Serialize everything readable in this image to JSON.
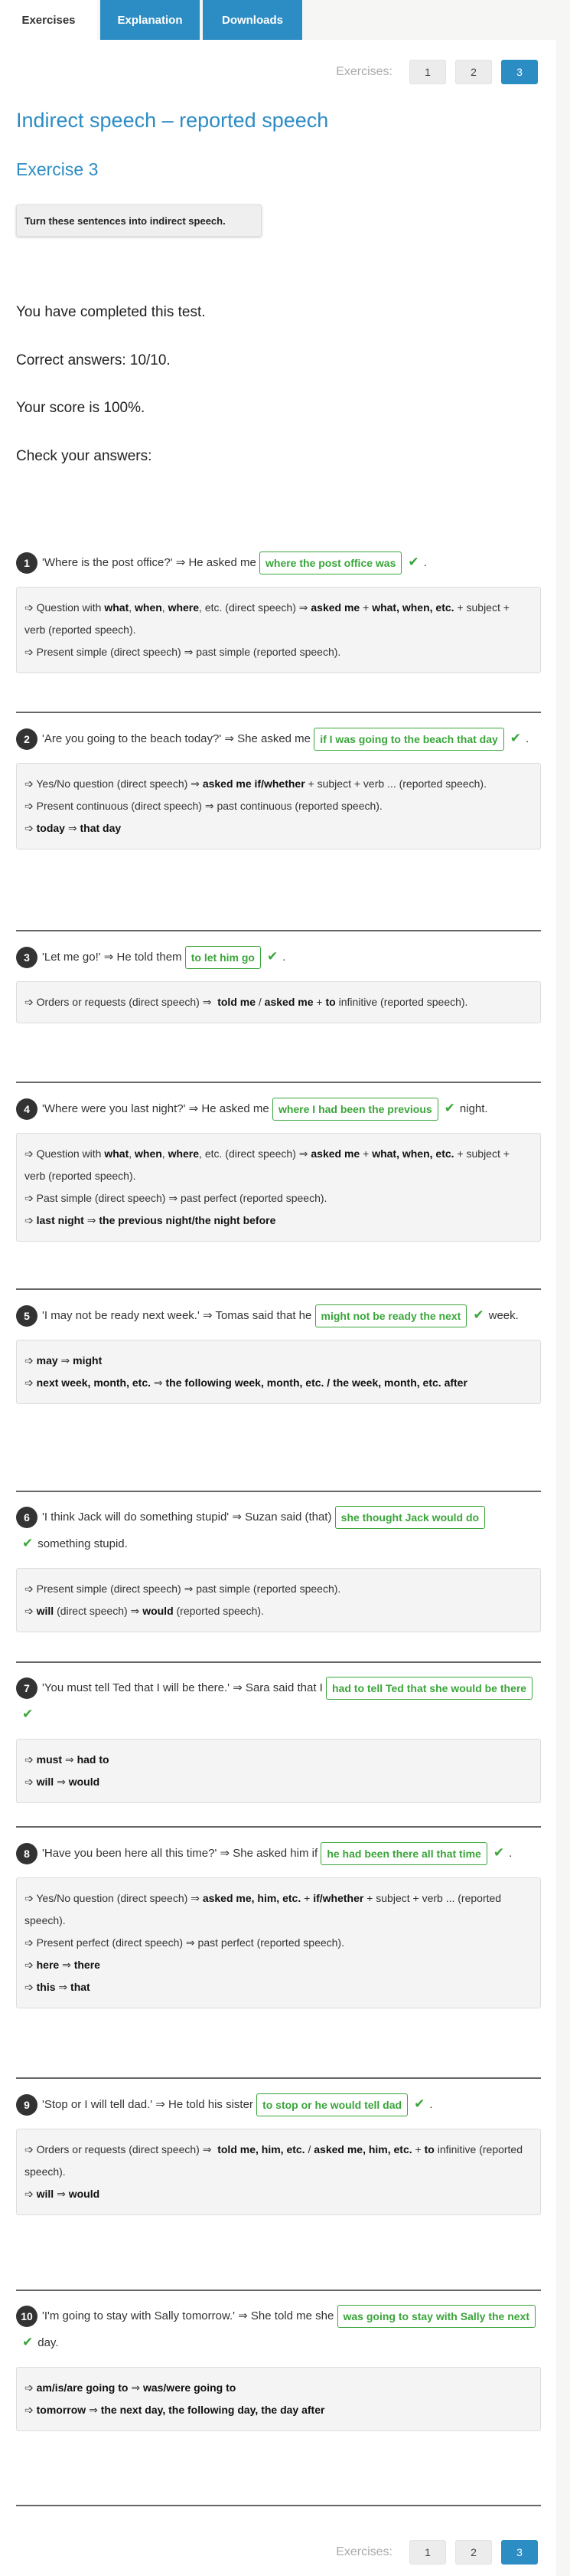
{
  "tabs": [
    {
      "label": "Exercises",
      "active": true
    },
    {
      "label": "Explanation",
      "active": false
    },
    {
      "label": "Downloads",
      "active": false
    }
  ],
  "pager": {
    "label": "Exercises:",
    "pages": [
      "1",
      "2",
      "3"
    ],
    "current": "3"
  },
  "title": "Indirect speech – reported speech",
  "subtitle": "Exercise 3",
  "instruction": "Turn these sentences into indirect speech.",
  "results": {
    "completed": "You have completed this test.",
    "correct": "Correct answers: 10/10.",
    "score": "Your score is 100%.",
    "check": "Check your answers:"
  },
  "questions": [
    {
      "num": "1",
      "before": "'Where is the post office?' ⇒ He asked me",
      "answer": "where the post office was",
      "after": ".",
      "notes": [
        "➩ Question with <b>what</b>, <b>when</b>, <b>where</b>, etc. (direct speech) ⇒ <b>asked me</b> + <b>what, when, etc.</b> + subject + verb (reported speech).",
        "➩ Present simple (direct speech) ⇒ past simple (reported speech)."
      ]
    },
    {
      "num": "2",
      "before": "'Are you going to the beach today?' ⇒ She asked me",
      "answer": "if I was going to the beach that day",
      "after": ".",
      "notes": [
        "➩ Yes/No question (direct speech) ⇒ <b>asked me if/whether</b> + subject + verb ... (reported speech).",
        "➩ Present continuous (direct speech) ⇒ past continuous (reported speech).",
        "➩ <b>today</b> ⇒ <b>that day</b>"
      ]
    },
    {
      "num": "3",
      "before": "'Let me go!' ⇒ He told them",
      "answer": "to let him go",
      "after": ".",
      "notes": [
        "➩ Orders or requests (direct speech) ⇒ &nbsp;<b>told me</b> / <b>asked me</b> + <b>to</b> infinitive (reported speech)."
      ]
    },
    {
      "num": "4",
      "before": "'Where were you last night?' ⇒ He asked me",
      "answer": "where I had been the previous",
      "after": "night.",
      "notes": [
        "➩ Question with <b>what</b>, <b>when</b>, <b>where</b>, etc. (direct speech) ⇒ <b>asked me</b> + <b>what, when, etc.</b> + subject + verb (reported speech).",
        "➩ Past simple (direct speech) ⇒ past perfect (reported speech).",
        "➩ <b>last night</b> ⇒ <b>the previous night/the night before</b>"
      ]
    },
    {
      "num": "5",
      "before": "'I may not be ready next week.' ⇒ Tomas said that he",
      "answer": "might not be ready the next",
      "after": "week.",
      "notes": [
        "➩ <b>may</b> ⇒ <b>might</b>",
        "➩ <b>next week, month, etc.</b> ⇒ <b>the following week, month, etc. / the week, month, etc. after</b>"
      ]
    },
    {
      "num": "6",
      "before": "'I think Jack will do something stupid' ⇒ Suzan said (that)",
      "answer": "she thought Jack would do",
      "after": "something stupid.",
      "notes": [
        "➩ Present simple (direct speech) ⇒ past simple (reported speech).",
        "➩ <b>will</b> (direct speech) ⇒ <b>would</b> (reported speech)."
      ]
    },
    {
      "num": "7",
      "before": "'You must tell Ted that I will be there.' ⇒ Sara said that I",
      "answer": "had to tell Ted that she would be there",
      "after": "",
      "notes": [
        "➩ <b>must</b> ⇒ <b>had to</b>",
        "➩ <b>will</b> ⇒ <b>would</b>"
      ]
    },
    {
      "num": "8",
      "before": "'Have you been here all this time?' ⇒ She asked him if",
      "answer": "he had been there all that time",
      "after": ".",
      "notes": [
        "➩ Yes/No question (direct speech) ⇒ <b>asked me, him, etc.</b> + <b>if/whether</b> + subject + verb ... (reported speech).",
        "➩ Present perfect (direct speech) ⇒ past perfect (reported speech).",
        "➩ <b>here</b> ⇒ <b>there</b>",
        "➩ <b>this</b> ⇒ <b>that</b>"
      ]
    },
    {
      "num": "9",
      "before": "'Stop or I will tell dad.' ⇒ He told his sister",
      "answer": "to stop or he would tell dad",
      "after": ".",
      "notes": [
        "➩ Orders or requests (direct speech) ⇒ &nbsp;<b>told me, him, etc.</b> / <b>asked me, him, etc.</b> + <b>to</b> infinitive (reported speech).",
        "➩ <b>will</b> ⇒ <b>would</b>"
      ]
    },
    {
      "num": "10",
      "before": "'I'm going to stay with Sally tomorrow.' ⇒ She told me she",
      "answer": "was going to stay with Sally the next",
      "after": "day.",
      "notes": [
        "➩ <b>am/is/are going to</b> ⇒ <b>was/were going to</b>",
        "➩ <b>tomorrow</b> ⇒ <b>the next day, the following day, the day after</b>"
      ]
    }
  ]
}
